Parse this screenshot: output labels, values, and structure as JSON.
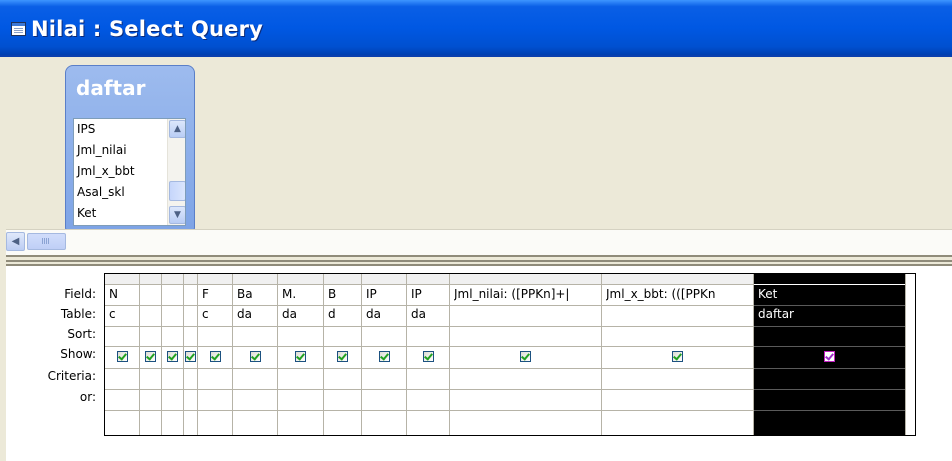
{
  "window": {
    "title": "Nilai : Select Query"
  },
  "table": {
    "name": "daftar",
    "fields": [
      "IPS",
      "Jml_nilai",
      "Jml_x_bbt",
      "Asal_skl",
      "Ket"
    ]
  },
  "row_labels": [
    "Field:",
    "Table:",
    "Sort:",
    "Show:",
    "Criteria:",
    "or:"
  ],
  "columns": [
    {
      "field": "N",
      "table": "c",
      "show": true
    },
    {
      "field": "",
      "table": "",
      "show": true
    },
    {
      "field": "",
      "table": "",
      "show": true
    },
    {
      "field": "",
      "table": "",
      "show": true
    },
    {
      "field": "F",
      "table": "c",
      "show": true
    },
    {
      "field": "Ba",
      "table": "da",
      "show": true
    },
    {
      "field": "M.",
      "table": "da",
      "show": true
    },
    {
      "field": "B",
      "table": "d",
      "show": true
    },
    {
      "field": "IP",
      "table": "da",
      "show": true
    },
    {
      "field": "IP",
      "table": "da",
      "show": true
    },
    {
      "field": "Jml_nilai: ([PPKn]+|",
      "table": "",
      "show": true
    },
    {
      "field": "Jml_x_bbt: (([PPKn",
      "table": "",
      "show": true
    },
    {
      "field": "Ket",
      "table": "daftar",
      "show": true,
      "selected": true
    }
  ],
  "icons": {
    "window": "query-window-icon",
    "scroll_up": "arrow-up-icon",
    "scroll_down": "arrow-down-icon",
    "scroll_left": "arrow-left-icon"
  },
  "colors": {
    "titlebar": "#0058e3",
    "table_header": "#7ea4e6",
    "selected_column": "#000000"
  }
}
